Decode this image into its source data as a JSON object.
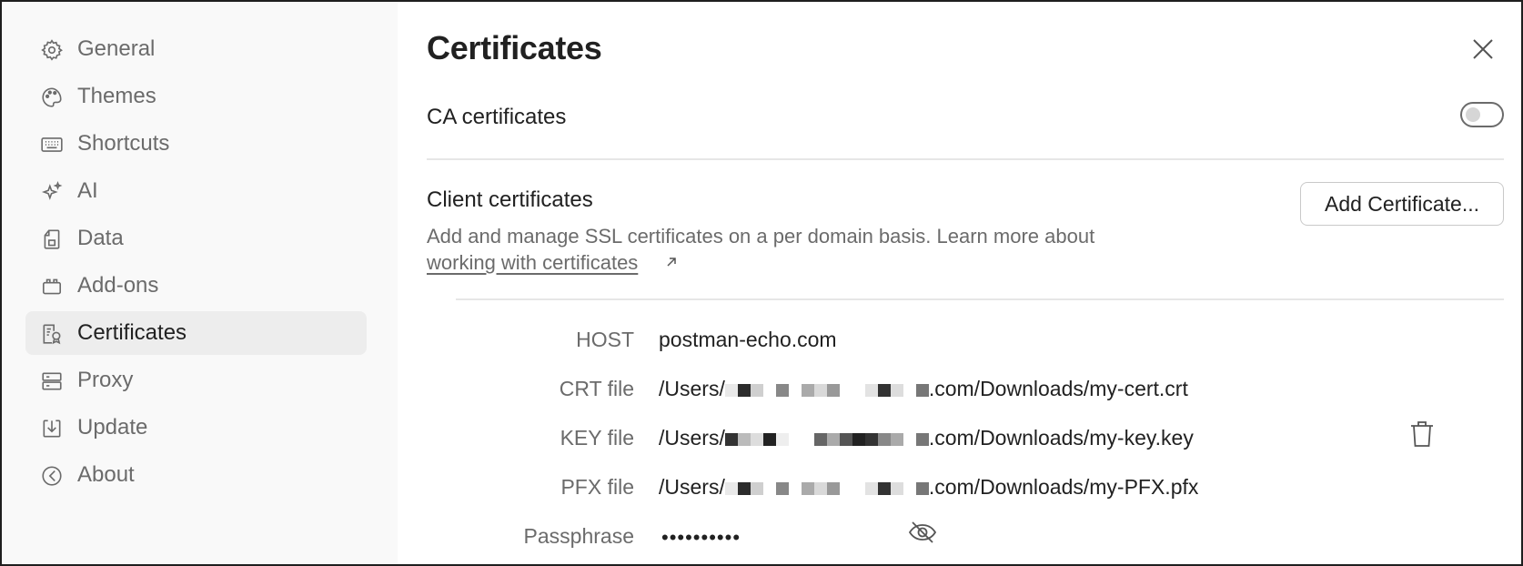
{
  "sidebar": {
    "items": [
      {
        "label": "General",
        "icon": "gear-icon"
      },
      {
        "label": "Themes",
        "icon": "palette-icon"
      },
      {
        "label": "Shortcuts",
        "icon": "keyboard-icon"
      },
      {
        "label": "AI",
        "icon": "sparkle-icon"
      },
      {
        "label": "Data",
        "icon": "data-icon"
      },
      {
        "label": "Add-ons",
        "icon": "add-ons-icon"
      },
      {
        "label": "Certificates",
        "icon": "certificate-icon",
        "active": true
      },
      {
        "label": "Proxy",
        "icon": "proxy-icon"
      },
      {
        "label": "Update",
        "icon": "download-icon"
      },
      {
        "label": "About",
        "icon": "about-icon"
      }
    ]
  },
  "main": {
    "title": "Certificates",
    "ca": {
      "label": "CA certificates",
      "enabled": false
    },
    "client": {
      "title": "Client certificates",
      "description": "Add and manage SSL certificates on a per domain basis. Learn more about",
      "link_text": "working with certificates",
      "add_button": "Add Certificate..."
    },
    "certificate": {
      "host_label": "HOST",
      "host": "postman-echo.com",
      "crt_label": "CRT file",
      "crt_prefix": "/Users/",
      "crt_suffix": ".com/Downloads/my-cert.crt",
      "key_label": "KEY file",
      "key_prefix": "/Users/",
      "key_suffix": ".com/Downloads/my-key.key",
      "pfx_label": "PFX file",
      "pfx_prefix": "/Users/",
      "pfx_suffix": ".com/Downloads/my-PFX.pfx",
      "passphrase_label": "Passphrase",
      "passphrase_masked": "••••••••••"
    }
  },
  "colors": {
    "text_primary": "#212121",
    "text_secondary": "#6b6b6b",
    "sidebar_bg": "#f9f9f9",
    "active_bg": "#ededed",
    "divider": "#e6e6e6"
  }
}
